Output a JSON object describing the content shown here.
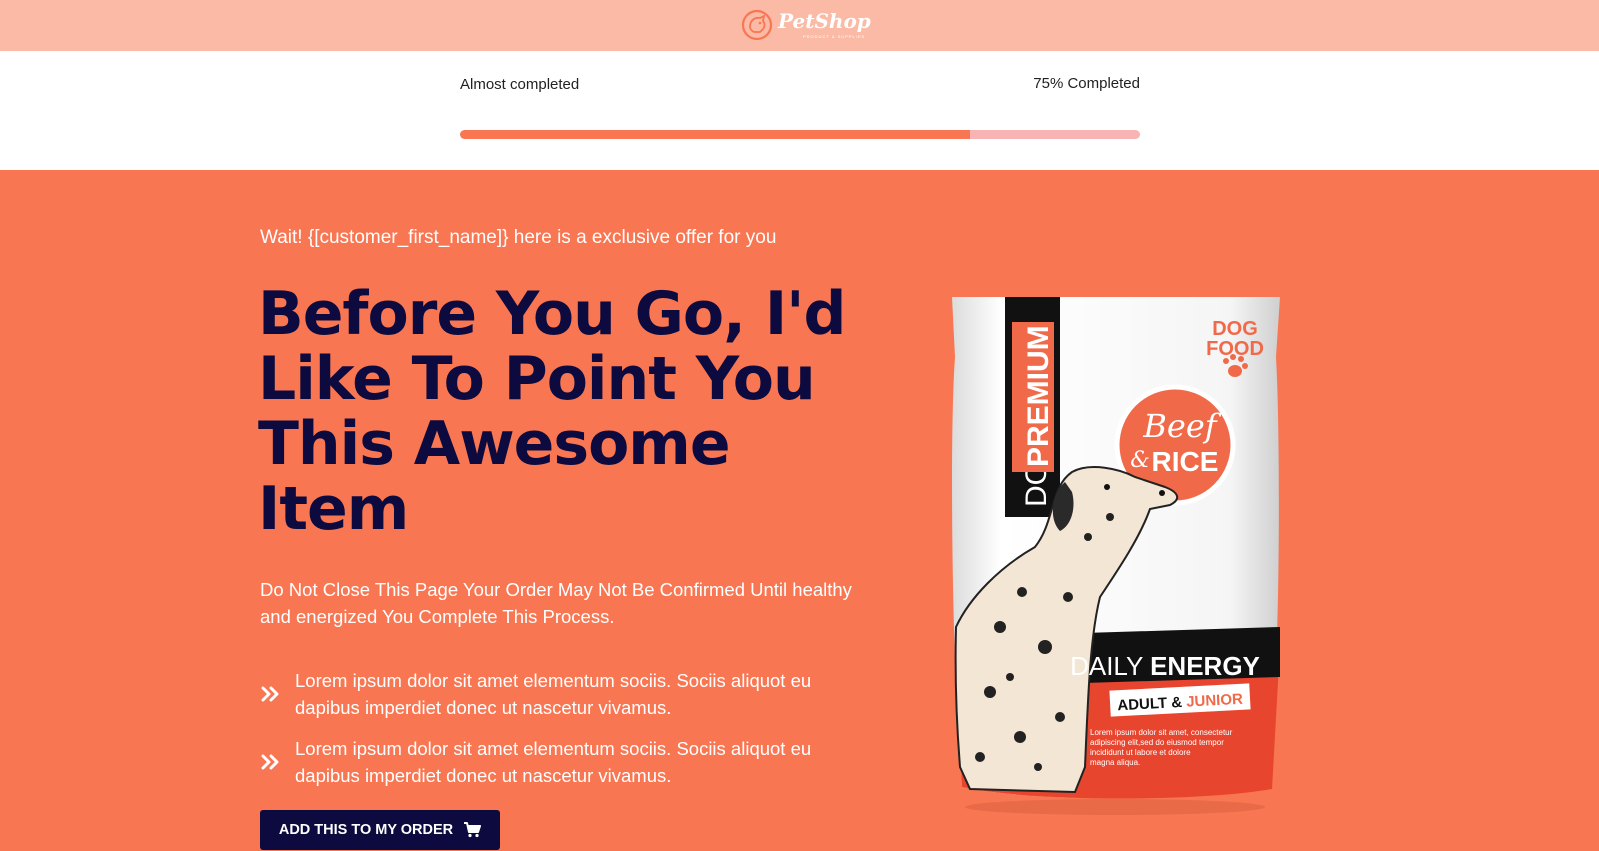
{
  "brand": {
    "name": "PetShop",
    "tagline": "PRODUCT & SUPPLIES"
  },
  "progress": {
    "label": "Almost completed",
    "percent_text": "75% Completed",
    "value": 0.75
  },
  "offer": {
    "eyebrow": "Wait! {[customer_first_name]} here is a exclusive offer for you",
    "headline": "Before You Go, I'd Like To Point You This Awesome Item",
    "subtext": "Do Not Close This Page Your Order May Not Be Confirmed Until healthy and energized You Complete This Process.",
    "bullets": [
      "Lorem ipsum dolor sit amet elementum sociis. Sociis aliquot eu dapibus imperdiet donec ut nascetur vivamus.",
      "Lorem ipsum dolor sit amet elementum sociis. Sociis aliquot eu dapibus imperdiet donec ut nascetur vivamus."
    ],
    "cta_label": "ADD THIS TO MY ORDER"
  },
  "product": {
    "side_text_1": "DOG",
    "side_text_2": "PREMIUM",
    "corner_1": "DOG",
    "corner_2": "FOOD",
    "badge_1": "Beef",
    "badge_2": "&",
    "badge_3": "RICE",
    "band_1": "DAILY",
    "band_2": "ENERGY",
    "sub_1": "ADULT &",
    "sub_2": "JUNIOR",
    "fine_1": "Lorem ipsum dolor sit amet, consectetur",
    "fine_2": "adipiscing elit,sed do eiusmod tempor",
    "fine_3": "incididunt ut labore et dolore",
    "fine_4": "magna aliqua."
  },
  "colors": {
    "accent": "#f87652",
    "topbar": "#fbbaa6",
    "navy": "#0c0a3e",
    "track": "#f8b4b4"
  },
  "icons": {
    "logo": "dog-logo-icon",
    "bullet": "double-chevron-right-icon",
    "cart": "cart-icon"
  }
}
